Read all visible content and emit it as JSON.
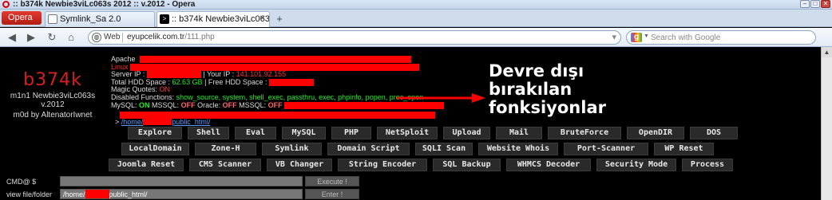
{
  "window": {
    "title": ":: b374k Newbie3viLc063s 2012 :: v.2012 - Opera"
  },
  "tabs": {
    "menu_label": "Opera",
    "items": [
      {
        "label": "Symlink_Sa 2.0"
      },
      {
        "label": ":: b374k Newbie3viLc063s ..."
      }
    ],
    "new_tab": "+"
  },
  "address": {
    "web_label": "Web",
    "host": "eyupcelik.com.tr",
    "path": "/111.php",
    "search_placeholder": "Search with Google"
  },
  "brand": {
    "name": "b374k",
    "version": "m1n1 Newbie3viLc063s v.2012",
    "mod": "m0d by AltenatorIwnet"
  },
  "info": {
    "apache_label": "Apache",
    "linux_label": "Linux",
    "server_ip_label": "Server IP :",
    "your_ip_label": "| Your IP :",
    "your_ip_value": "141.101.92.155",
    "hdd_label": "Total HDD Space :",
    "hdd_value": "62.63 GB",
    "free_label": "| Free HDD Space :",
    "magic_label": "Magic Quotes:",
    "magic_value": "ON",
    "disabled_label": "Disabled Functions:",
    "disabled_value": "show_source, system, shell_exec, passthru, exec, phpinfo, popen, proc_open",
    "mysql_label": "MySQL:",
    "mysql_value": "ON",
    "mssql_label": "MSSQL:",
    "mssql_value": "OFF",
    "oracle_label": "Oracle:",
    "oracle_value": "OFF",
    "mssql2_label": "MSSQL:",
    "mssql2_value": "OFF"
  },
  "annotation": {
    "line1": "Devre dışı",
    "line2": "bırakılan",
    "line3": "fonksiyonlar"
  },
  "path": {
    "prefix": ">",
    "home": "/home/",
    "rest": "public_html/"
  },
  "menu": {
    "row1": [
      "Explore",
      "Shell",
      "Eval",
      "MySQL",
      "PHP",
      "NetSploit",
      "Upload",
      "Mail",
      "BruteForce",
      "OpenDIR",
      "DOS"
    ],
    "row2": [
      "LocalDomain",
      "Zone-H",
      "Symlink",
      "Domain Script",
      "SQLI Scan",
      "Website Whois",
      "Port-Scanner",
      "WP Reset"
    ],
    "row3": [
      "Joomla Reset",
      "CMS Scanner",
      "VB Changer",
      "String Encoder",
      "SQL Backup",
      "WHMCS Decoder",
      "Security Mode",
      "Process"
    ]
  },
  "cmd": {
    "label": "CMD@ $",
    "button": "Execute !"
  },
  "viewfile": {
    "label": "view file/folder",
    "value_prefix": "/home/",
    "value_suffix": "public_html/",
    "button": "Enter !"
  },
  "colors": {
    "redaction": "#ff0000",
    "accent_red": "#d62020",
    "enabled_green": "#22ee22"
  }
}
